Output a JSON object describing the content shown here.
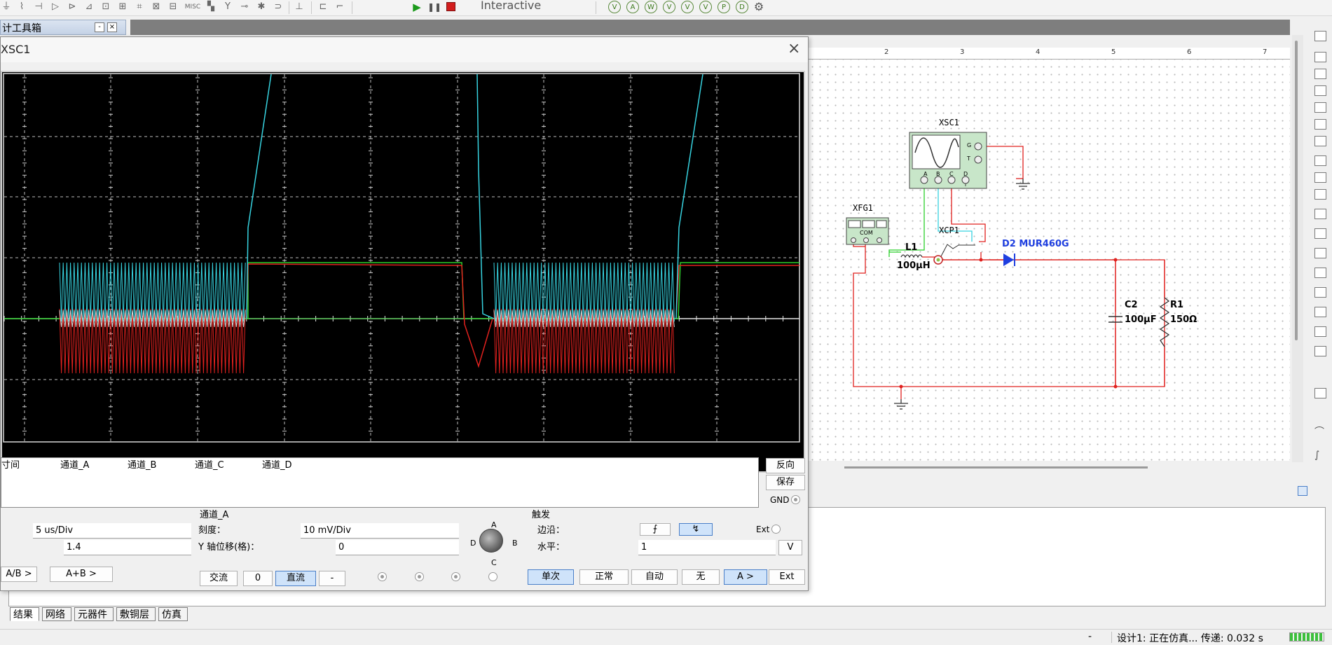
{
  "toolbar": {
    "interactive_label": "Interactive",
    "misc_label": "MISC"
  },
  "toolbox": {
    "title": "计工具箱",
    "min_symbol": "-",
    "close_symbol": "×"
  },
  "scope_window": {
    "title": "XSC1",
    "close_symbol": "×",
    "readout_headers": [
      "寸间",
      "通道_A",
      "通道_B",
      "通道_C",
      "通道_D"
    ],
    "reverse_label": "反向",
    "save_label": "保存",
    "gnd_label": "GND",
    "timebase": {
      "scale_value": "5 us/Div",
      "x_position": "1.4",
      "ab_label": "A/B >",
      "aplusb_label": "A+B >"
    },
    "channel": {
      "title": "通道_A",
      "scale_label": "刻度：",
      "scale_value": "10 mV/Div",
      "ypos_label": "Y 轴位移(格)：",
      "ypos_value": "0",
      "ac_label": "交流",
      "zero_label": "0",
      "dc_label": "直流",
      "minus_label": "-",
      "knob_labels": {
        "a": "A",
        "b": "B",
        "c": "C",
        "d": "D"
      }
    },
    "trigger": {
      "title": "触发",
      "edge_label": "边沿：",
      "ext_label": "Ext",
      "level_label": "水平：",
      "level_value": "1",
      "level_unit": "V",
      "single_label": "单次",
      "normal_label": "正常",
      "auto_label": "自动",
      "none_label": "无",
      "a_label": "A >",
      "ext_btn_label": "Ext"
    }
  },
  "schematic": {
    "ruler_ticks": [
      "2",
      "3",
      "4",
      "5",
      "6",
      "7"
    ],
    "xsc1_label": "XSC1",
    "xsc1_pins": [
      "A",
      "B",
      "C",
      "D"
    ],
    "xsc1_gt": [
      "G",
      "T"
    ],
    "xfg1_label": "XFG1",
    "xfg1_com": "COM",
    "xcp1_label": "XCP1",
    "l1_label": "L1",
    "l1_value": "100μH",
    "d2_label": "D2 MUR460G",
    "c2_label": "C2",
    "c2_value": "100μF",
    "r1_label": "R1",
    "r1_value": "150Ω"
  },
  "bottom_tabs": [
    "结果",
    "网络",
    "元器件",
    "敷铜层",
    "仿真"
  ],
  "status": {
    "dash": "-",
    "text": "设计1: 正在仿真... 传递: 0.032 s"
  },
  "colors": {
    "trace_a": "#37d3e0",
    "trace_b": "#e0211e",
    "trace_c": "#2bd02b",
    "wire": "#e0211e",
    "diode": "#1f3fe0"
  }
}
